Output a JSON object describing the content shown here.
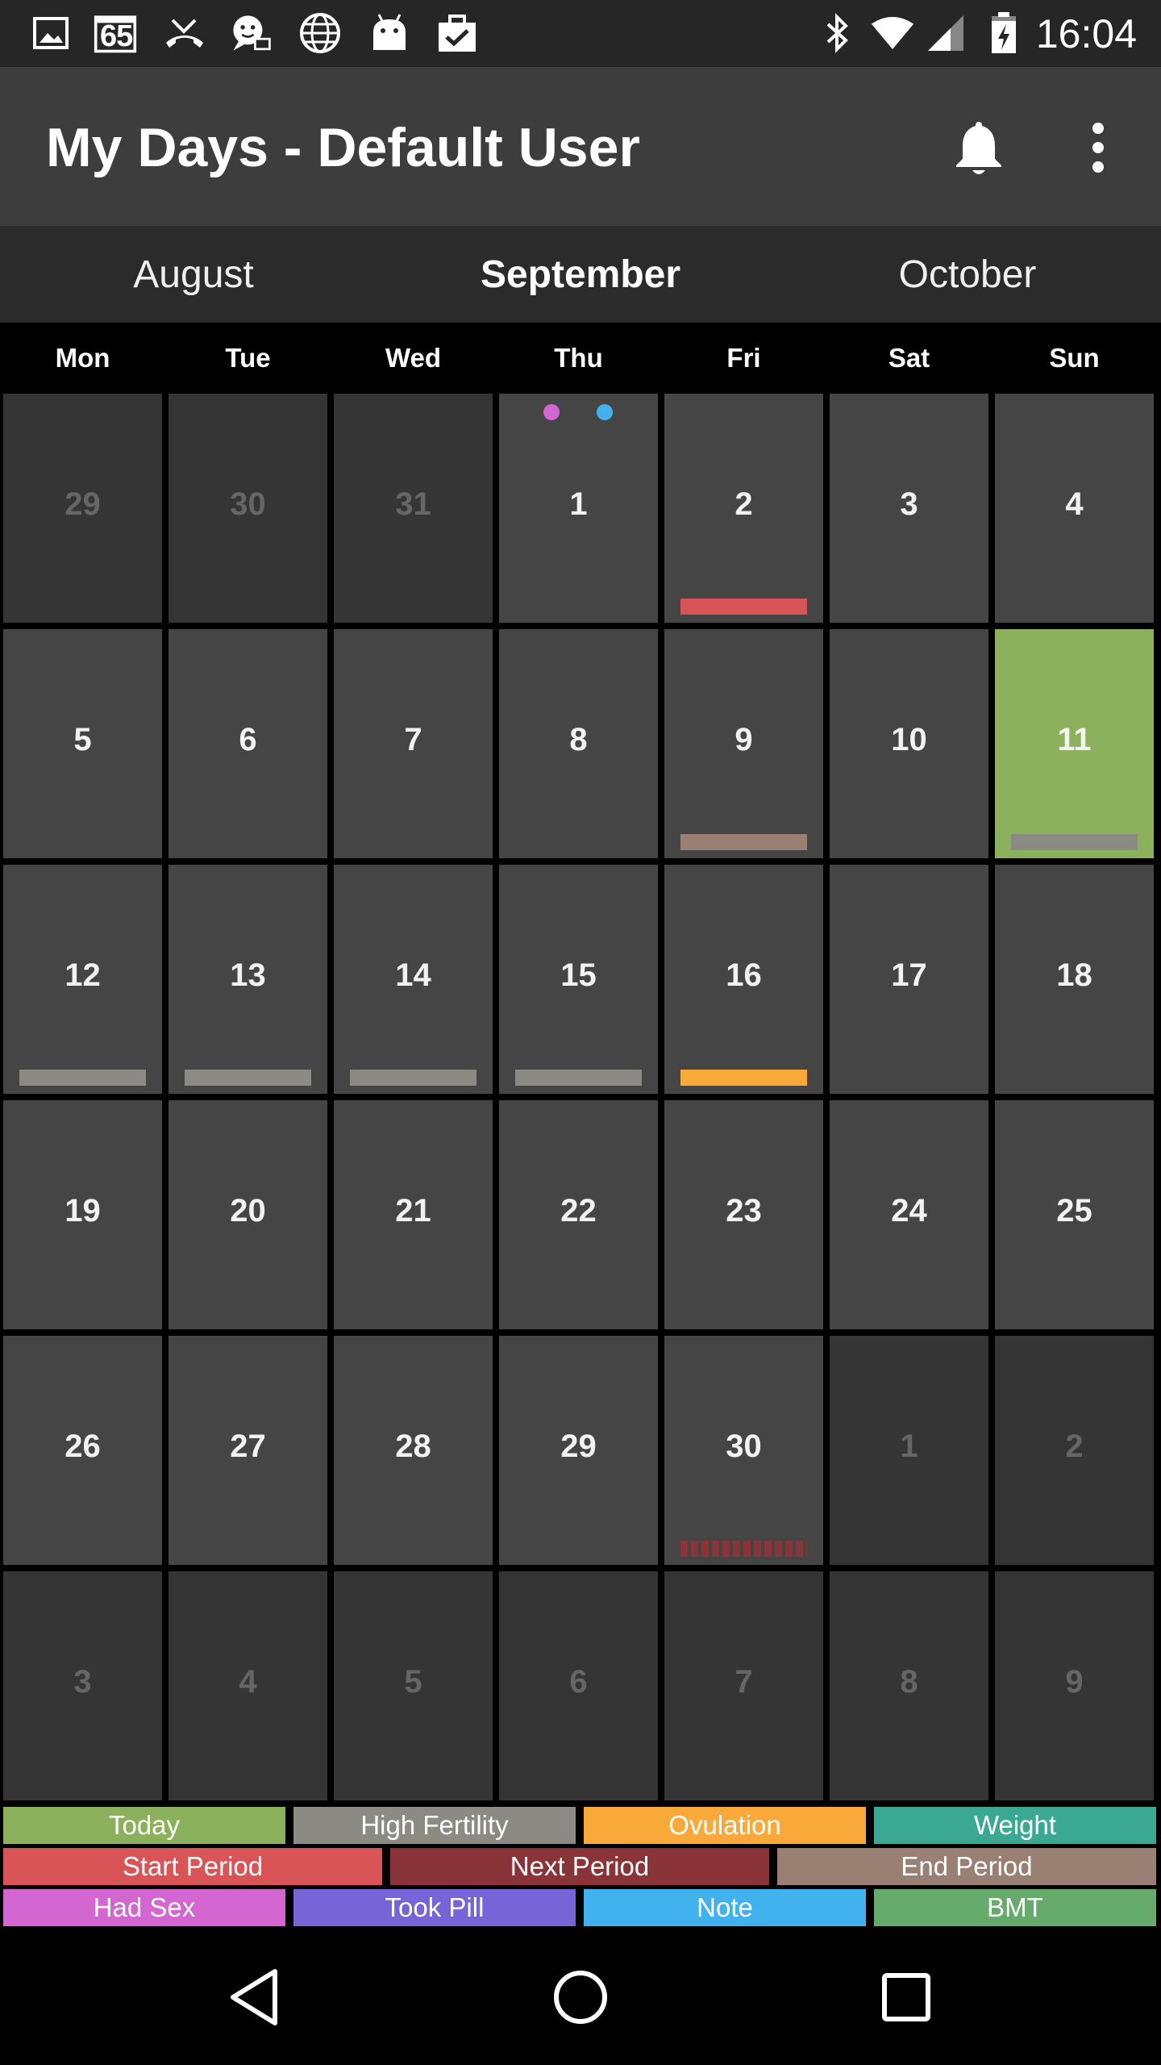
{
  "status_bar": {
    "time": "16:04",
    "left_icons": [
      "image-icon",
      "calendar-65-icon",
      "missed-call-icon",
      "chat-bubble-icon",
      "globe-icon",
      "android-icon",
      "clipboard-check-icon"
    ],
    "calendar_badge": "65",
    "right_icons": [
      "bluetooth-icon",
      "wifi-icon",
      "signal-icon",
      "battery-icon"
    ]
  },
  "app_bar": {
    "title": "My Days - Default User",
    "actions": [
      "bell-icon",
      "overflow-menu-icon"
    ]
  },
  "months": {
    "previous": "August",
    "current": "September",
    "next": "October"
  },
  "weekdays": [
    "Mon",
    "Tue",
    "Wed",
    "Thu",
    "Fri",
    "Sat",
    "Sun"
  ],
  "calendar": {
    "weeks": [
      [
        {
          "day": "29",
          "other": true
        },
        {
          "day": "30",
          "other": true
        },
        {
          "day": "31",
          "other": true
        },
        {
          "day": "1",
          "dots": [
            "had_sex",
            "note"
          ]
        },
        {
          "day": "2",
          "marker": "start_period"
        },
        {
          "day": "3"
        },
        {
          "day": "4"
        }
      ],
      [
        {
          "day": "5"
        },
        {
          "day": "6"
        },
        {
          "day": "7"
        },
        {
          "day": "8"
        },
        {
          "day": "9",
          "marker": "end_period"
        },
        {
          "day": "10"
        },
        {
          "day": "11",
          "today": true,
          "marker": "high_fertility"
        }
      ],
      [
        {
          "day": "12",
          "marker": "high_fertility"
        },
        {
          "day": "13",
          "marker": "high_fertility"
        },
        {
          "day": "14",
          "marker": "high_fertility"
        },
        {
          "day": "15",
          "marker": "high_fertility"
        },
        {
          "day": "16",
          "marker": "ovulation"
        },
        {
          "day": "17"
        },
        {
          "day": "18"
        }
      ],
      [
        {
          "day": "19"
        },
        {
          "day": "20"
        },
        {
          "day": "21"
        },
        {
          "day": "22"
        },
        {
          "day": "23"
        },
        {
          "day": "24"
        },
        {
          "day": "25"
        }
      ],
      [
        {
          "day": "26"
        },
        {
          "day": "27"
        },
        {
          "day": "28"
        },
        {
          "day": "29"
        },
        {
          "day": "30",
          "marker": "next_period"
        },
        {
          "day": "1",
          "other": true
        },
        {
          "day": "2",
          "other": true
        }
      ],
      [
        {
          "day": "3",
          "other": true
        },
        {
          "day": "4",
          "other": true
        },
        {
          "day": "5",
          "other": true
        },
        {
          "day": "6",
          "other": true
        },
        {
          "day": "7",
          "other": true
        },
        {
          "day": "8",
          "other": true
        },
        {
          "day": "9",
          "other": true
        }
      ]
    ]
  },
  "legend": {
    "row1": [
      {
        "key": "today",
        "label": "Today",
        "color": "#8bb15c"
      },
      {
        "key": "high_fertility",
        "label": "High Fertility",
        "color": "#8b8b84"
      },
      {
        "key": "ovulation",
        "label": "Ovulation",
        "color": "#f9a93a"
      },
      {
        "key": "weight",
        "label": "Weight",
        "color": "#3aa892"
      }
    ],
    "row2": [
      {
        "key": "start_period",
        "label": "Start Period",
        "color": "#d95456"
      },
      {
        "key": "next_period",
        "label": "Next Period",
        "color": "#8a3338"
      },
      {
        "key": "end_period",
        "label": "End Period",
        "color": "#9a7f73"
      }
    ],
    "row3": [
      {
        "key": "had_sex",
        "label": "Had Sex",
        "color": "#d366d1"
      },
      {
        "key": "took_pill",
        "label": "Took Pill",
        "color": "#7764d6"
      },
      {
        "key": "note",
        "label": "Note",
        "color": "#42b2ee"
      },
      {
        "key": "bmt",
        "label": "BMT",
        "color": "#67ab6c"
      }
    ]
  },
  "nav_bar": {
    "buttons": [
      "back-icon",
      "home-icon",
      "recents-icon"
    ]
  }
}
